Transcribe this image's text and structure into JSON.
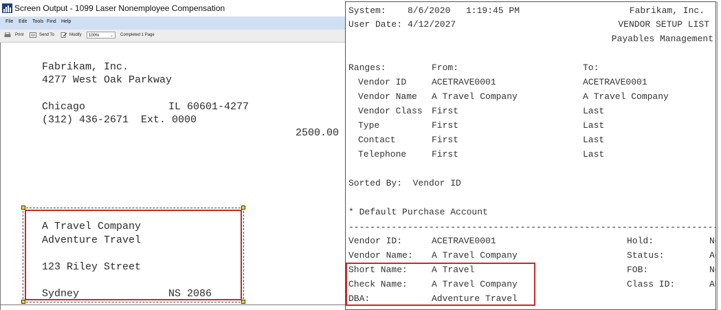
{
  "left_window": {
    "title": "Screen Output - 1099 Laser Nonemployee Compensation",
    "menu": [
      "File",
      "Edit",
      "Tools",
      "Find",
      "Help"
    ],
    "toolbar": {
      "print_label": "Print",
      "send_to_label": "Send To",
      "modify_label": "Modify",
      "zoom_value": "100%",
      "status": "Completed 1 Page"
    },
    "report": {
      "company": "Fabrikam, Inc.",
      "street": "4277 West Oak Parkway",
      "city": "Chicago",
      "state_zip": "IL 60601-4277",
      "phone": "(312) 436-2671  Ext. 0000",
      "amount": "2500.00",
      "recipient_name": "A Travel Company",
      "recipient_dba": "Adventure Travel",
      "recipient_street": "123 Riley Street",
      "recipient_city": "Sydney",
      "recipient_state_zip": "NS 2086"
    }
  },
  "right_window": {
    "system_label": "System:",
    "system_date": "8/6/2020",
    "system_time": "1:19:45 PM",
    "company": "Fabrikam, Inc.",
    "user_date_label": "User Date:",
    "user_date": "4/12/2027",
    "report_title": "VENDOR SETUP LIST",
    "module": "Payables Management",
    "ranges_label": "Ranges:",
    "from_label": "From:",
    "to_label": "To:",
    "ranges": [
      {
        "label": "Vendor ID",
        "from": "ACETRAVE0001",
        "to": "ACETRAVE0001"
      },
      {
        "label": "Vendor Name",
        "from": "A Travel Company",
        "to": "A Travel Company"
      },
      {
        "label": "Vendor Class",
        "from": "First",
        "to": "Last"
      },
      {
        "label": "Type",
        "from": "First",
        "to": "Last"
      },
      {
        "label": "Contact",
        "from": "First",
        "to": "Last"
      },
      {
        "label": "Telephone",
        "from": "First",
        "to": "Last"
      }
    ],
    "sorted_by": "Sorted By:  Vendor ID",
    "default_purchase": "* Default Purchase Account",
    "dashes": "------------------------------------------------------------------------------",
    "vendor_fields": [
      {
        "label": "Vendor ID:",
        "value": "ACETRAVE0001"
      },
      {
        "label": "Vendor Name:",
        "value": "A Travel Company"
      },
      {
        "label": "Short Name:",
        "value": "A Travel"
      },
      {
        "label": "Check Name:",
        "value": "A Travel Company"
      },
      {
        "label": "DBA:",
        "value": "Adventure Travel"
      }
    ],
    "side_fields": [
      {
        "label": "Hold:",
        "value": "No"
      },
      {
        "label": "Status:",
        "value": "Ac"
      },
      {
        "label": "FOB:",
        "value": "No"
      },
      {
        "label": "Class ID:",
        "value": "AU"
      }
    ]
  }
}
